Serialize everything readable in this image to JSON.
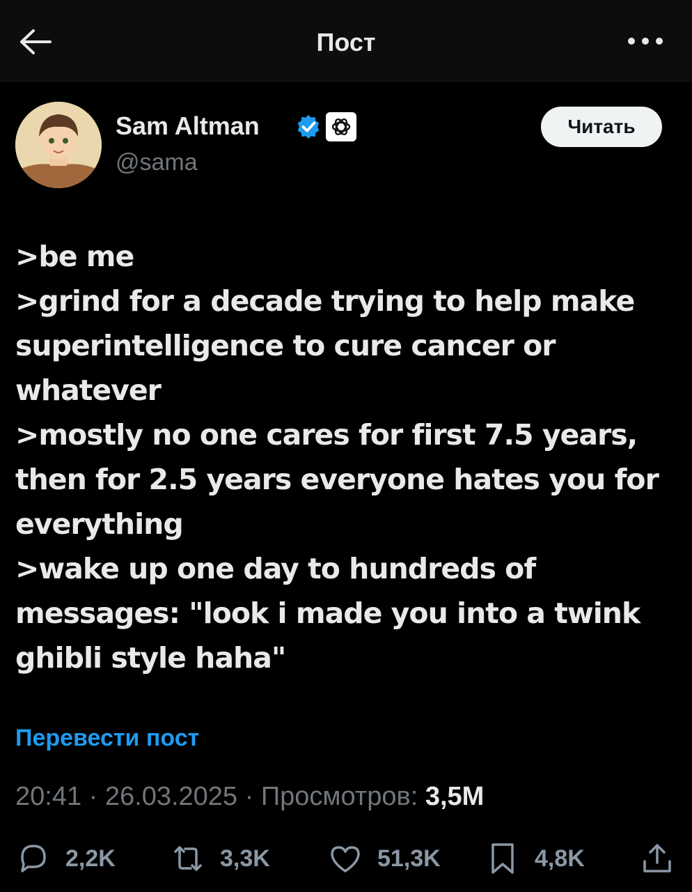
{
  "header": {
    "title": "Пост",
    "back_icon": "arrow-left-icon",
    "more_icon": "more-horizontal-icon"
  },
  "author": {
    "name": "Sam Altman",
    "handle": "@sama",
    "verified_color": "#1d9bf0",
    "affiliate_icon": "openai-logo-icon",
    "follow_label": "Читать"
  },
  "post": {
    "lines": [
      ">be me",
      ">grind for a decade trying to help make",
      "superintelligence to cure cancer or",
      "whatever",
      ">mostly no one cares for first 7.5 years,",
      "then for 2.5 years everyone hates you for",
      "everything",
      ">wake up one day to hundreds of",
      "messages: \"look i made you into a twink",
      "ghibli style haha\""
    ],
    "translate_label": "Перевести пост"
  },
  "meta": {
    "time": "20:41",
    "date": "26.03.2025",
    "views_label": "Просмотров:",
    "views": "3,5M",
    "separator": "·"
  },
  "actions": {
    "replies": "2,2K",
    "reposts": "3,3K",
    "likes": "51,3K",
    "bookmarks": "4,8K"
  },
  "colors": {
    "background": "#000000",
    "accent": "#1d9bf0",
    "muted": "#71767b"
  }
}
